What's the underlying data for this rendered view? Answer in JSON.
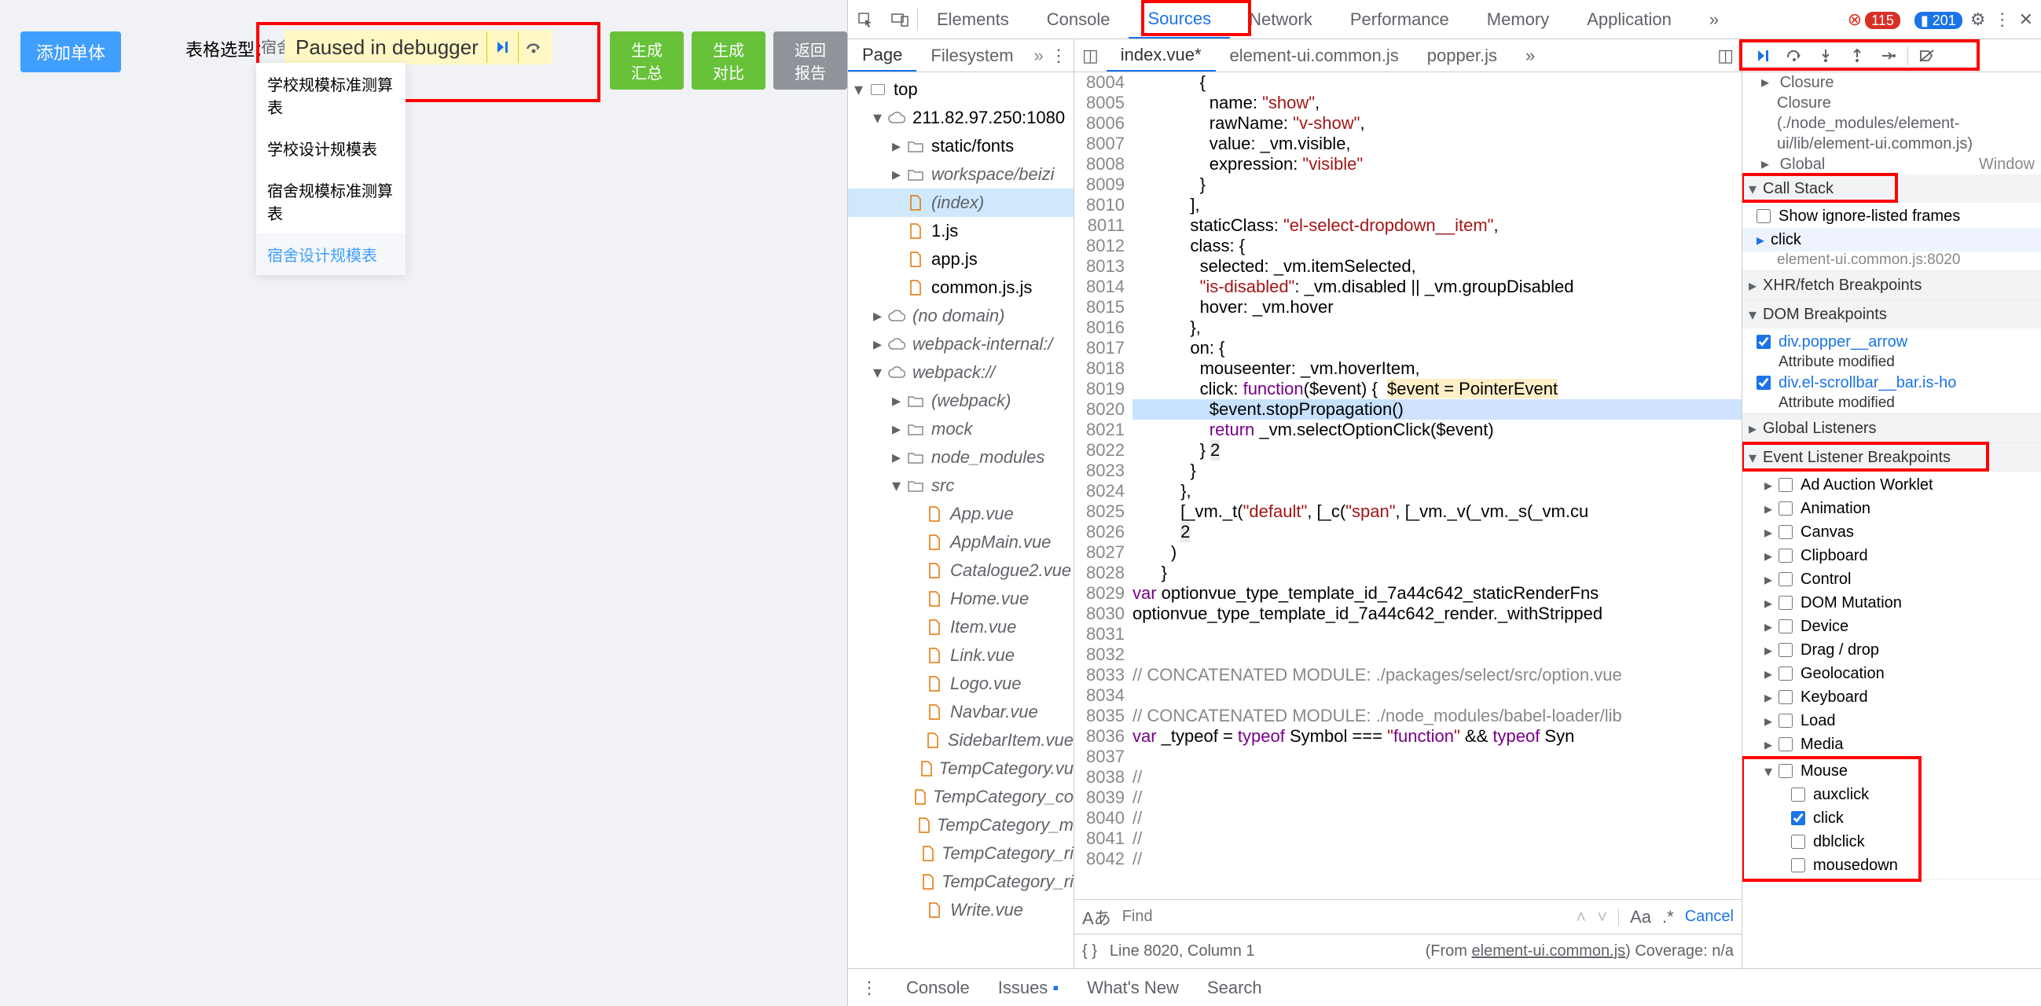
{
  "app": {
    "add_btn": "添加单体",
    "select_label": "表格选型：",
    "sel_partial": "宿舍",
    "dropdown": [
      "学校规模标准测算表",
      "学校设计规模表",
      "宿舍规模标准测算表",
      "宿舍设计规模表"
    ],
    "paused": "Paused in debugger",
    "btns": [
      "生成汇总",
      "生成对比",
      "返回报告"
    ]
  },
  "tabs": {
    "items": [
      "Elements",
      "Console",
      "Sources",
      "Network",
      "Performance",
      "Memory",
      "Application"
    ],
    "more": "»",
    "err": "115",
    "info": "201"
  },
  "nav": {
    "tabs": [
      "Page",
      "Filesystem"
    ],
    "more": "»"
  },
  "tree": {
    "top": "top",
    "host": "211.82.97.250:1080",
    "folders": [
      "static/fonts",
      "workspace/beizi"
    ],
    "files1": [
      "(index)",
      "1.js",
      "app.js",
      "common.js.js"
    ],
    "extra": [
      "(no domain)",
      "webpack-internal:/"
    ],
    "wp": "webpack://",
    "wp_sub": [
      "(webpack)",
      "mock",
      "node_modules",
      "src"
    ],
    "src_files": [
      "App.vue",
      "AppMain.vue",
      "Catalogue2.vue",
      "Home.vue",
      "Item.vue",
      "Link.vue",
      "Logo.vue",
      "Navbar.vue",
      "SidebarItem.vue",
      "TempCategory.vu",
      "TempCategory_co",
      "TempCategory_m",
      "TempCategory_ri",
      "TempCategory_ri",
      "Write.vue"
    ]
  },
  "files": {
    "tabs": [
      "index.vue*",
      "element-ui.common.js",
      "popper.js"
    ],
    "more": "»"
  },
  "code": {
    "start": 8004,
    "lines": [
      "              {",
      "                name: \"show\",",
      "                rawName: \"v-show\",",
      "                value: _vm.visible,",
      "                expression: \"visible\"",
      "              }",
      "            ],",
      "            staticClass: \"el-select-dropdown__item\",",
      "            class: {",
      "              selected: _vm.itemSelected,",
      "              \"is-disabled\": _vm.disabled || _vm.groupDisabled",
      "              hover: _vm.hover",
      "            },",
      "            on: {",
      "              mouseenter: _vm.hoverItem,",
      "              click: function($event) {  $event = PointerEvent",
      "                $event.stopPropagation()",
      "                return _vm.selectOptionClick($event)",
      "              } 2",
      "            }",
      "          },",
      "          [_vm._t(\"default\", [_c(\"span\", [_vm._v(_vm._s(_vm.cu",
      "          2",
      "        )",
      "      }",
      "var optionvue_type_template_id_7a44c642_staticRenderFns",
      "optionvue_type_template_id_7a44c642_render._withStripped",
      "",
      "",
      "// CONCATENATED MODULE: ./packages/select/src/option.vue",
      "",
      "// CONCATENATED MODULE: ./node_modules/babel-loader/lib",
      "var _typeof = typeof Symbol === \"function\" && typeof Syn",
      "",
      "//",
      "//",
      "//",
      "//",
      "//"
    ]
  },
  "find": {
    "placeholder": "Find",
    "aa": "Aa",
    "re": ".*",
    "cancel": "Cancel"
  },
  "status": {
    "pos": "Line 8020, Column 1",
    "from": "(From ",
    "link": "element-ui.common.js",
    "cov": ") Coverage: n/a"
  },
  "scope": {
    "closure1": "Closure",
    "closure2": "Closure",
    "closure_src": "(./node_modules/element-ui/lib/element-ui.common.js)",
    "global": "Global",
    "window": "Window"
  },
  "callstack": {
    "title": "Call Stack",
    "show_ignore": "Show ignore-listed frames",
    "frame": "click",
    "frame_src": "element-ui.common.js:8020"
  },
  "sections": {
    "xhr": "XHR/fetch Breakpoints",
    "dom": "DOM Breakpoints",
    "dom_items": [
      {
        "el": "div.popper__arrow",
        "mod": "Attribute modified"
      },
      {
        "el": "div.el-scrollbar__bar.is-ho",
        "mod": "Attribute modified"
      }
    ],
    "gl": "Global Listeners",
    "elb": "Event Listener Breakpoints",
    "elb_cats": [
      "Ad Auction Worklet",
      "Animation",
      "Canvas",
      "Clipboard",
      "Control",
      "DOM Mutation",
      "Device",
      "Drag / drop",
      "Geolocation",
      "Keyboard",
      "Load",
      "Media"
    ],
    "mouse": "Mouse",
    "mouse_items": [
      "auxclick",
      "click",
      "dblclick",
      "mousedown"
    ]
  },
  "drawer": {
    "console": "Console",
    "issues": "Issues",
    "new": "What's New",
    "search": "Search"
  }
}
